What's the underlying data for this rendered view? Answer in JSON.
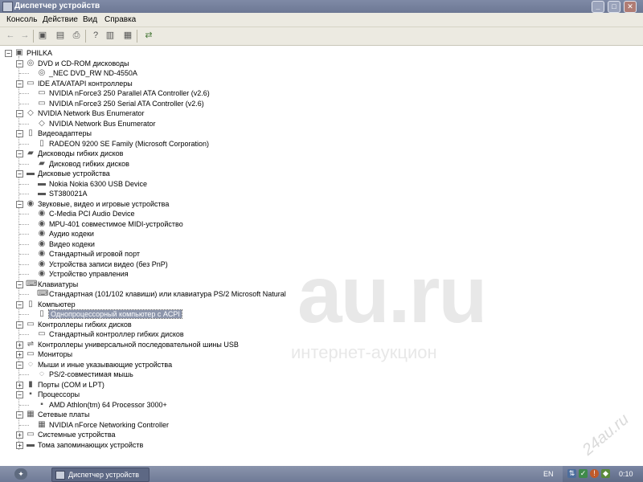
{
  "window": {
    "title": "Диспетчер устройств"
  },
  "menubar": {
    "items": [
      "Консоль",
      "Действие",
      "Вид",
      "Справка"
    ]
  },
  "toolbar": {
    "icons": [
      "back-icon",
      "forward-icon",
      "console-tree-icon",
      "properties-icon",
      "print-icon",
      "help-icon",
      "refresh-icon",
      "export-icon",
      "scan-hardware-icon"
    ]
  },
  "tree": {
    "root": "PHILKA",
    "categories": [
      {
        "label": "DVD и CD-ROM дисководы",
        "icon": "dvd-icon",
        "expanded": true,
        "children": [
          {
            "label": "_NEC DVD_RW ND-4550A",
            "icon": "dvd-icon"
          }
        ]
      },
      {
        "label": "IDE ATA/ATAPI контроллеры",
        "icon": "ide-controller-icon",
        "expanded": true,
        "children": [
          {
            "label": "NVIDIA nForce3 250 Parallel ATA Controller (v2.6)",
            "icon": "ide-controller-icon"
          },
          {
            "label": "NVIDIA nForce3 250 Serial ATA Controller (v2.6)",
            "icon": "ide-controller-icon"
          }
        ]
      },
      {
        "label": "NVIDIA Network Bus Enumerator",
        "icon": "network-bus-icon",
        "expanded": true,
        "children": [
          {
            "label": "NVIDIA Network Bus Enumerator",
            "icon": "network-bus-icon"
          }
        ]
      },
      {
        "label": "Видеоадаптеры",
        "icon": "display-adapter-icon",
        "expanded": true,
        "children": [
          {
            "label": "RADEON 9200 SE Family (Microsoft Corporation)",
            "icon": "display-adapter-icon"
          }
        ]
      },
      {
        "label": "Дисководы гибких дисков",
        "icon": "floppy-drive-icon",
        "expanded": true,
        "children": [
          {
            "label": "Дисковод гибких дисков",
            "icon": "floppy-drive-icon"
          }
        ]
      },
      {
        "label": "Дисковые устройства",
        "icon": "disk-drive-icon",
        "expanded": true,
        "children": [
          {
            "label": "Nokia Nokia 6300 USB Device",
            "icon": "disk-drive-icon"
          },
          {
            "label": "ST380021A",
            "icon": "disk-drive-icon"
          }
        ]
      },
      {
        "label": "Звуковые, видео и игровые устройства",
        "icon": "sound-device-icon",
        "expanded": true,
        "children": [
          {
            "label": "C-Media PCI Audio Device",
            "icon": "sound-device-icon"
          },
          {
            "label": "MPU-401 совместимое MIDI-устройство",
            "icon": "sound-device-icon"
          },
          {
            "label": "Аудио кодеки",
            "icon": "sound-device-icon"
          },
          {
            "label": "Видео кодеки",
            "icon": "sound-device-icon"
          },
          {
            "label": "Стандартный игровой порт",
            "icon": "sound-device-icon"
          },
          {
            "label": "Устройства записи видео (без PnP)",
            "icon": "sound-device-icon"
          },
          {
            "label": "Устройство управления",
            "icon": "sound-device-icon"
          }
        ]
      },
      {
        "label": "Клавиатуры",
        "icon": "keyboard-icon",
        "expanded": true,
        "children": [
          {
            "label": "Стандартная (101/102 клавиши) или клавиатура PS/2 Microsoft Natural",
            "icon": "keyboard-icon"
          }
        ]
      },
      {
        "label": "Компьютер",
        "icon": "computer-icon",
        "expanded": true,
        "children": [
          {
            "label": "Однопроцессорный компьютер с ACPI",
            "icon": "computer-icon",
            "selected": true
          }
        ]
      },
      {
        "label": "Контроллеры гибких дисков",
        "icon": "floppy-controller-icon",
        "expanded": true,
        "children": [
          {
            "label": "Стандартный контроллер гибких дисков",
            "icon": "floppy-controller-icon"
          }
        ]
      },
      {
        "label": "Контроллеры универсальной последовательной шины USB",
        "icon": "usb-icon",
        "expanded": false,
        "children": []
      },
      {
        "label": "Мониторы",
        "icon": "monitor-icon",
        "expanded": false,
        "children": []
      },
      {
        "label": "Мыши и иные указывающие устройства",
        "icon": "mouse-icon",
        "expanded": true,
        "children": [
          {
            "label": "PS/2-совместимая мышь",
            "icon": "mouse-icon"
          }
        ]
      },
      {
        "label": "Порты (COM и LPT)",
        "icon": "port-icon",
        "expanded": false,
        "children": []
      },
      {
        "label": "Процессоры",
        "icon": "processor-icon",
        "expanded": true,
        "children": [
          {
            "label": "AMD Athlon(tm) 64 Processor 3000+",
            "icon": "processor-icon"
          }
        ]
      },
      {
        "label": "Сетевые платы",
        "icon": "network-card-icon",
        "expanded": true,
        "children": [
          {
            "label": "NVIDIA nForce Networking Controller",
            "icon": "network-card-icon"
          }
        ]
      },
      {
        "label": "Системные устройства",
        "icon": "system-device-icon",
        "expanded": false,
        "children": []
      },
      {
        "label": "Тома запоминающих устройств",
        "icon": "storage-volume-icon",
        "expanded": false,
        "children": []
      }
    ]
  },
  "watermark": {
    "main": "au.ru",
    "sub": "интернет-аукцион",
    "corner": "24au.ru"
  },
  "taskbar": {
    "task_label": "Диспетчер устройств",
    "language": "EN",
    "clock": "0:10"
  }
}
